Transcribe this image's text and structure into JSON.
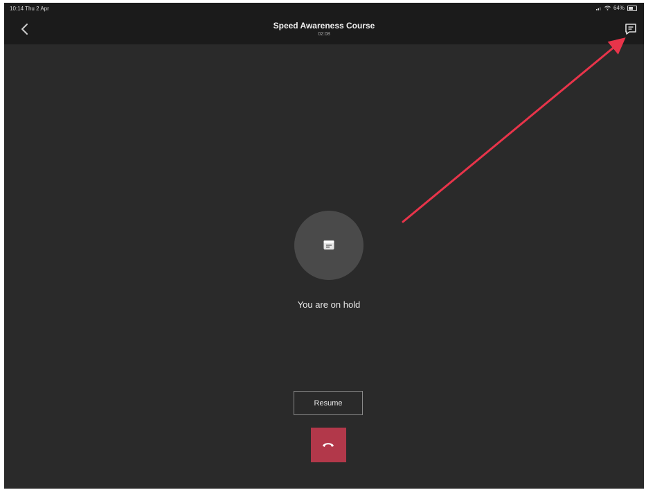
{
  "status_bar": {
    "time": "10:14  Thu 2 Apr",
    "battery": "64%",
    "battery_level": 0.64
  },
  "nav": {
    "title": "Speed Awareness Course",
    "elapsed": "02:08"
  },
  "call": {
    "status": "You are on hold",
    "resume_label": "Resume"
  },
  "colors": {
    "background": "#2a2a2a",
    "bar": "#1b1b1b",
    "hangup": "#b2384a",
    "annotation_arrow": "#e8344a"
  },
  "icons": {
    "back": "chevron-left-icon",
    "chat": "chat-icon",
    "avatar": "calendar-icon",
    "hangup": "phone-hangup-icon",
    "wifi": "wifi-icon",
    "signal": "signal-icon",
    "battery": "battery-icon"
  }
}
